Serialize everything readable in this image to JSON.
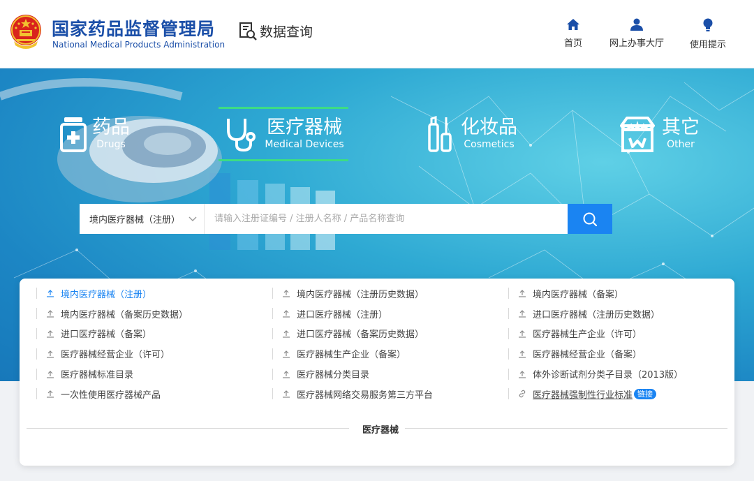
{
  "header": {
    "title_cn": "国家药品监督管理局",
    "title_en": "National Medical Products Administration",
    "query_label": "数据查询",
    "nav": [
      {
        "label": "首页",
        "icon": "home-icon"
      },
      {
        "label": "网上办事大厅",
        "icon": "user-icon"
      },
      {
        "label": "使用提示",
        "icon": "lightbulb-icon"
      }
    ]
  },
  "categories": [
    {
      "cn": "药品",
      "en": "Drugs",
      "icon": "medicine-bottle-icon"
    },
    {
      "cn": "医疗器械",
      "en": "Medical Devices",
      "icon": "stethoscope-icon",
      "active": true
    },
    {
      "cn": "化妆品",
      "en": "Cosmetics",
      "icon": "cosmetics-icon"
    },
    {
      "cn": "其它",
      "en": "Other",
      "icon": "store-icon"
    }
  ],
  "search": {
    "select_value": "境内医疗器械（注册）",
    "placeholder": "请输入注册证编号 / 注册人名称 / 产品名称查询"
  },
  "links": [
    "境内医疗器械（注册）",
    "境内医疗器械（注册历史数据）",
    "境内医疗器械（备案）",
    "境内医疗器械（备案历史数据）",
    "进口医疗器械（注册）",
    "进口医疗器械（注册历史数据）",
    "进口医疗器械（备案）",
    "进口医疗器械（备案历史数据）",
    "医疗器械生产企业（许可）",
    "医疗器械经营企业（许可）",
    "医疗器械生产企业（备案）",
    "医疗器械经营企业（备案）",
    "医疗器械标准目录",
    "医疗器械分类目录",
    "体外诊断试剂分类子目录（2013版）",
    "一次性使用医疗器械产品",
    "医疗器械网络交易服务第三方平台",
    "医疗器械强制性行业标准"
  ],
  "link_badge": "链接",
  "section_label": "医疗器械",
  "colors": {
    "brand": "#1b4fa8",
    "accent": "#1a84f2",
    "active_tab": "#3ddc84"
  }
}
